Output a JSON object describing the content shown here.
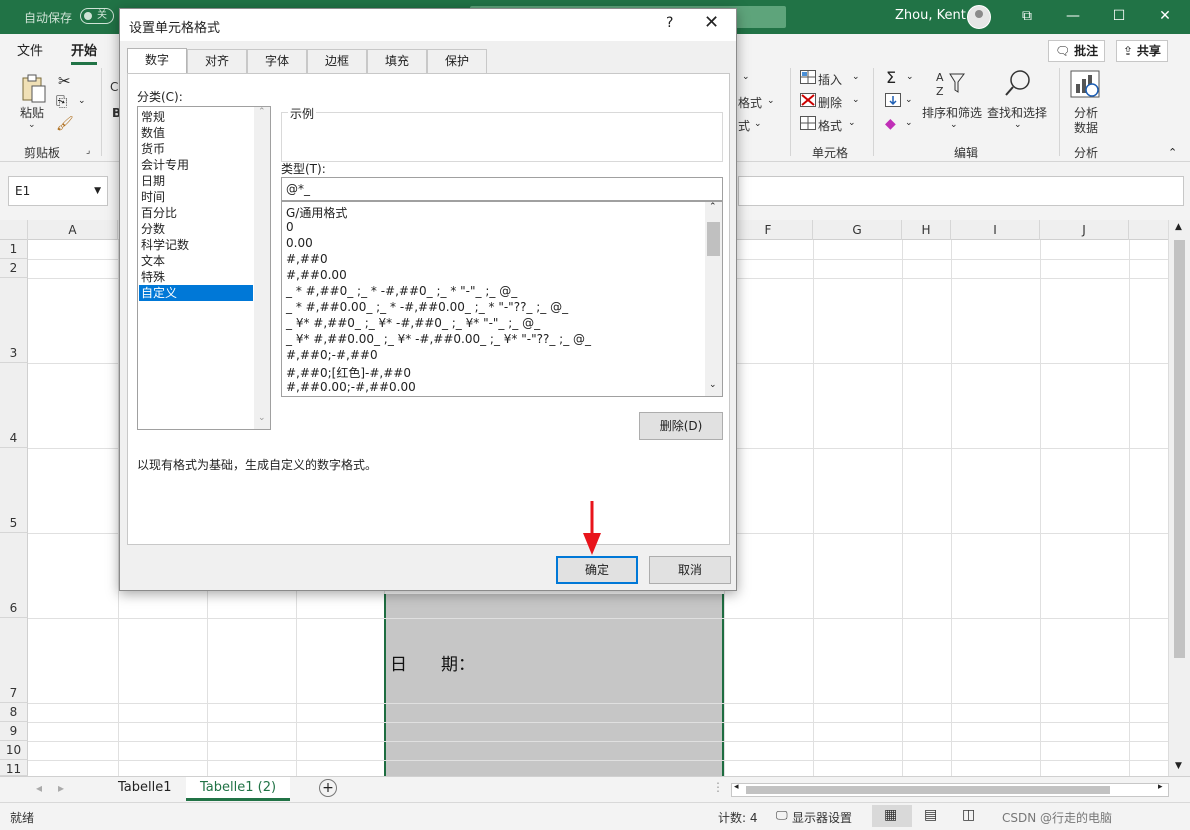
{
  "titlebar": {
    "autosave": "自动保存",
    "autosave_state": "关",
    "username": "Zhou, Kent"
  },
  "ribbon": {
    "tabs": [
      "文件",
      "开始"
    ],
    "comments_btn": "批注",
    "share_btn": "共享",
    "paste": "粘贴",
    "clipboard_group": "剪贴板",
    "format_table": "格式",
    "cell_style": "式",
    "insert": "插入",
    "delete": "删除",
    "format": "格式",
    "cells_group": "单元格",
    "sort_filter": "排序和筛选",
    "find_select": "查找和选择",
    "edit_group": "编辑",
    "analyze_data_1": "分析",
    "analyze_data_2": "数据",
    "analyze_group": "分析",
    "font_c": "C",
    "font_b": "B"
  },
  "formula_bar": {
    "name_box": "E1"
  },
  "grid": {
    "columns": [
      "A",
      "F",
      "G",
      "H",
      "I",
      "J"
    ],
    "rows": [
      "1",
      "2",
      "3",
      "4",
      "5",
      "6",
      "7",
      "8",
      "9",
      "10",
      "11"
    ],
    "date_cell": "日　　期："
  },
  "sheets": [
    "Tabelle1",
    "Tabelle1 (2)"
  ],
  "statusbar": {
    "ready": "就绪",
    "count": "计数: 4",
    "display_settings": "显示器设置",
    "watermark": "CSDN @行走的电脑"
  },
  "dialog": {
    "title": "设置单元格格式",
    "help": "?",
    "tabs": [
      "数字",
      "对齐",
      "字体",
      "边框",
      "填充",
      "保护"
    ],
    "category_label": "分类(C):",
    "categories": [
      "常规",
      "数值",
      "货币",
      "会计专用",
      "日期",
      "时间",
      "百分比",
      "分数",
      "科学记数",
      "文本",
      "特殊",
      "自定义"
    ],
    "sample_label": "示例",
    "type_label": "类型(T):",
    "type_value": "@*_",
    "formats": [
      "G/通用格式",
      "0",
      "0.00",
      "#,##0",
      "#,##0.00",
      "_ * #,##0_ ;_ * -#,##0_ ;_ * \"-\"_ ;_ @_",
      "_ * #,##0.00_ ;_ * -#,##0.00_ ;_ * \"-\"??_ ;_ @_",
      "_ ¥* #,##0_ ;_ ¥* -#,##0_ ;_ ¥* \"-\"_ ;_ @_",
      "_ ¥* #,##0.00_ ;_ ¥* -#,##0.00_ ;_ ¥* \"-\"??_ ;_ @_",
      "#,##0;-#,##0",
      "#,##0;[红色]-#,##0",
      "#,##0.00;-#,##0.00"
    ],
    "delete_btn": "删除(D)",
    "description": "以现有格式为基础，生成自定义的数字格式。",
    "ok": "确定",
    "cancel": "取消"
  },
  "colors": {
    "excel_green": "#217346",
    "selection_blue": "#0078d7",
    "annotation_arrow": "#e8141b"
  }
}
